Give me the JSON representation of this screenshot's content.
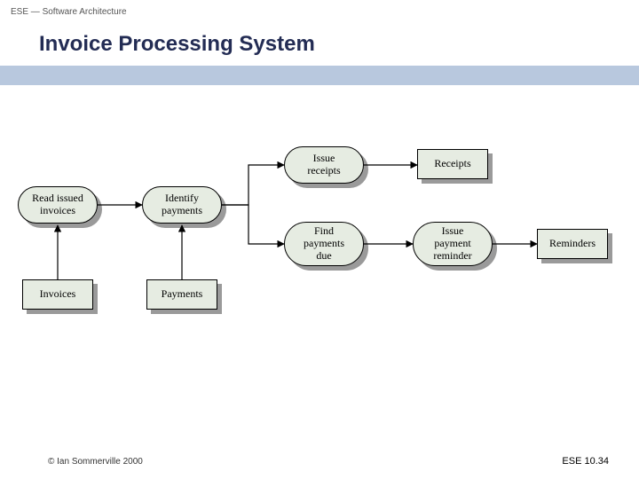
{
  "header": {
    "course": "ESE — Software Architecture"
  },
  "title": "Invoice Processing System",
  "footer": {
    "copyright": "© Ian Sommerville 2000",
    "page_ref": "ESE 10.34"
  },
  "nodes": {
    "read_issued_invoices": {
      "label": "Read issued\ninvoices",
      "kind": "process"
    },
    "identify_payments": {
      "label": "Identify\npayments",
      "kind": "process"
    },
    "issue_receipts": {
      "label": "Issue\nreceipts",
      "kind": "process"
    },
    "find_payments_due": {
      "label": "Find\npayments\ndue",
      "kind": "process"
    },
    "issue_payment_reminder": {
      "label": "Issue\npayment\nreminder",
      "kind": "process"
    },
    "invoices": {
      "label": "Invoices",
      "kind": "datastore"
    },
    "payments": {
      "label": "Payments",
      "kind": "datastore"
    },
    "receipts": {
      "label": "Receipts",
      "kind": "datastore"
    },
    "reminders": {
      "label": "Reminders",
      "kind": "datastore"
    }
  },
  "edges": [
    {
      "from": "read_issued_invoices",
      "to": "identify_payments"
    },
    {
      "from": "identify_payments",
      "to": "issue_receipts"
    },
    {
      "from": "identify_payments",
      "to": "find_payments_due"
    },
    {
      "from": "issue_receipts",
      "to": "receipts"
    },
    {
      "from": "find_payments_due",
      "to": "issue_payment_reminder"
    },
    {
      "from": "issue_payment_reminder",
      "to": "reminders"
    },
    {
      "from": "invoices",
      "to": "read_issued_invoices"
    },
    {
      "from": "payments",
      "to": "identify_payments"
    }
  ]
}
